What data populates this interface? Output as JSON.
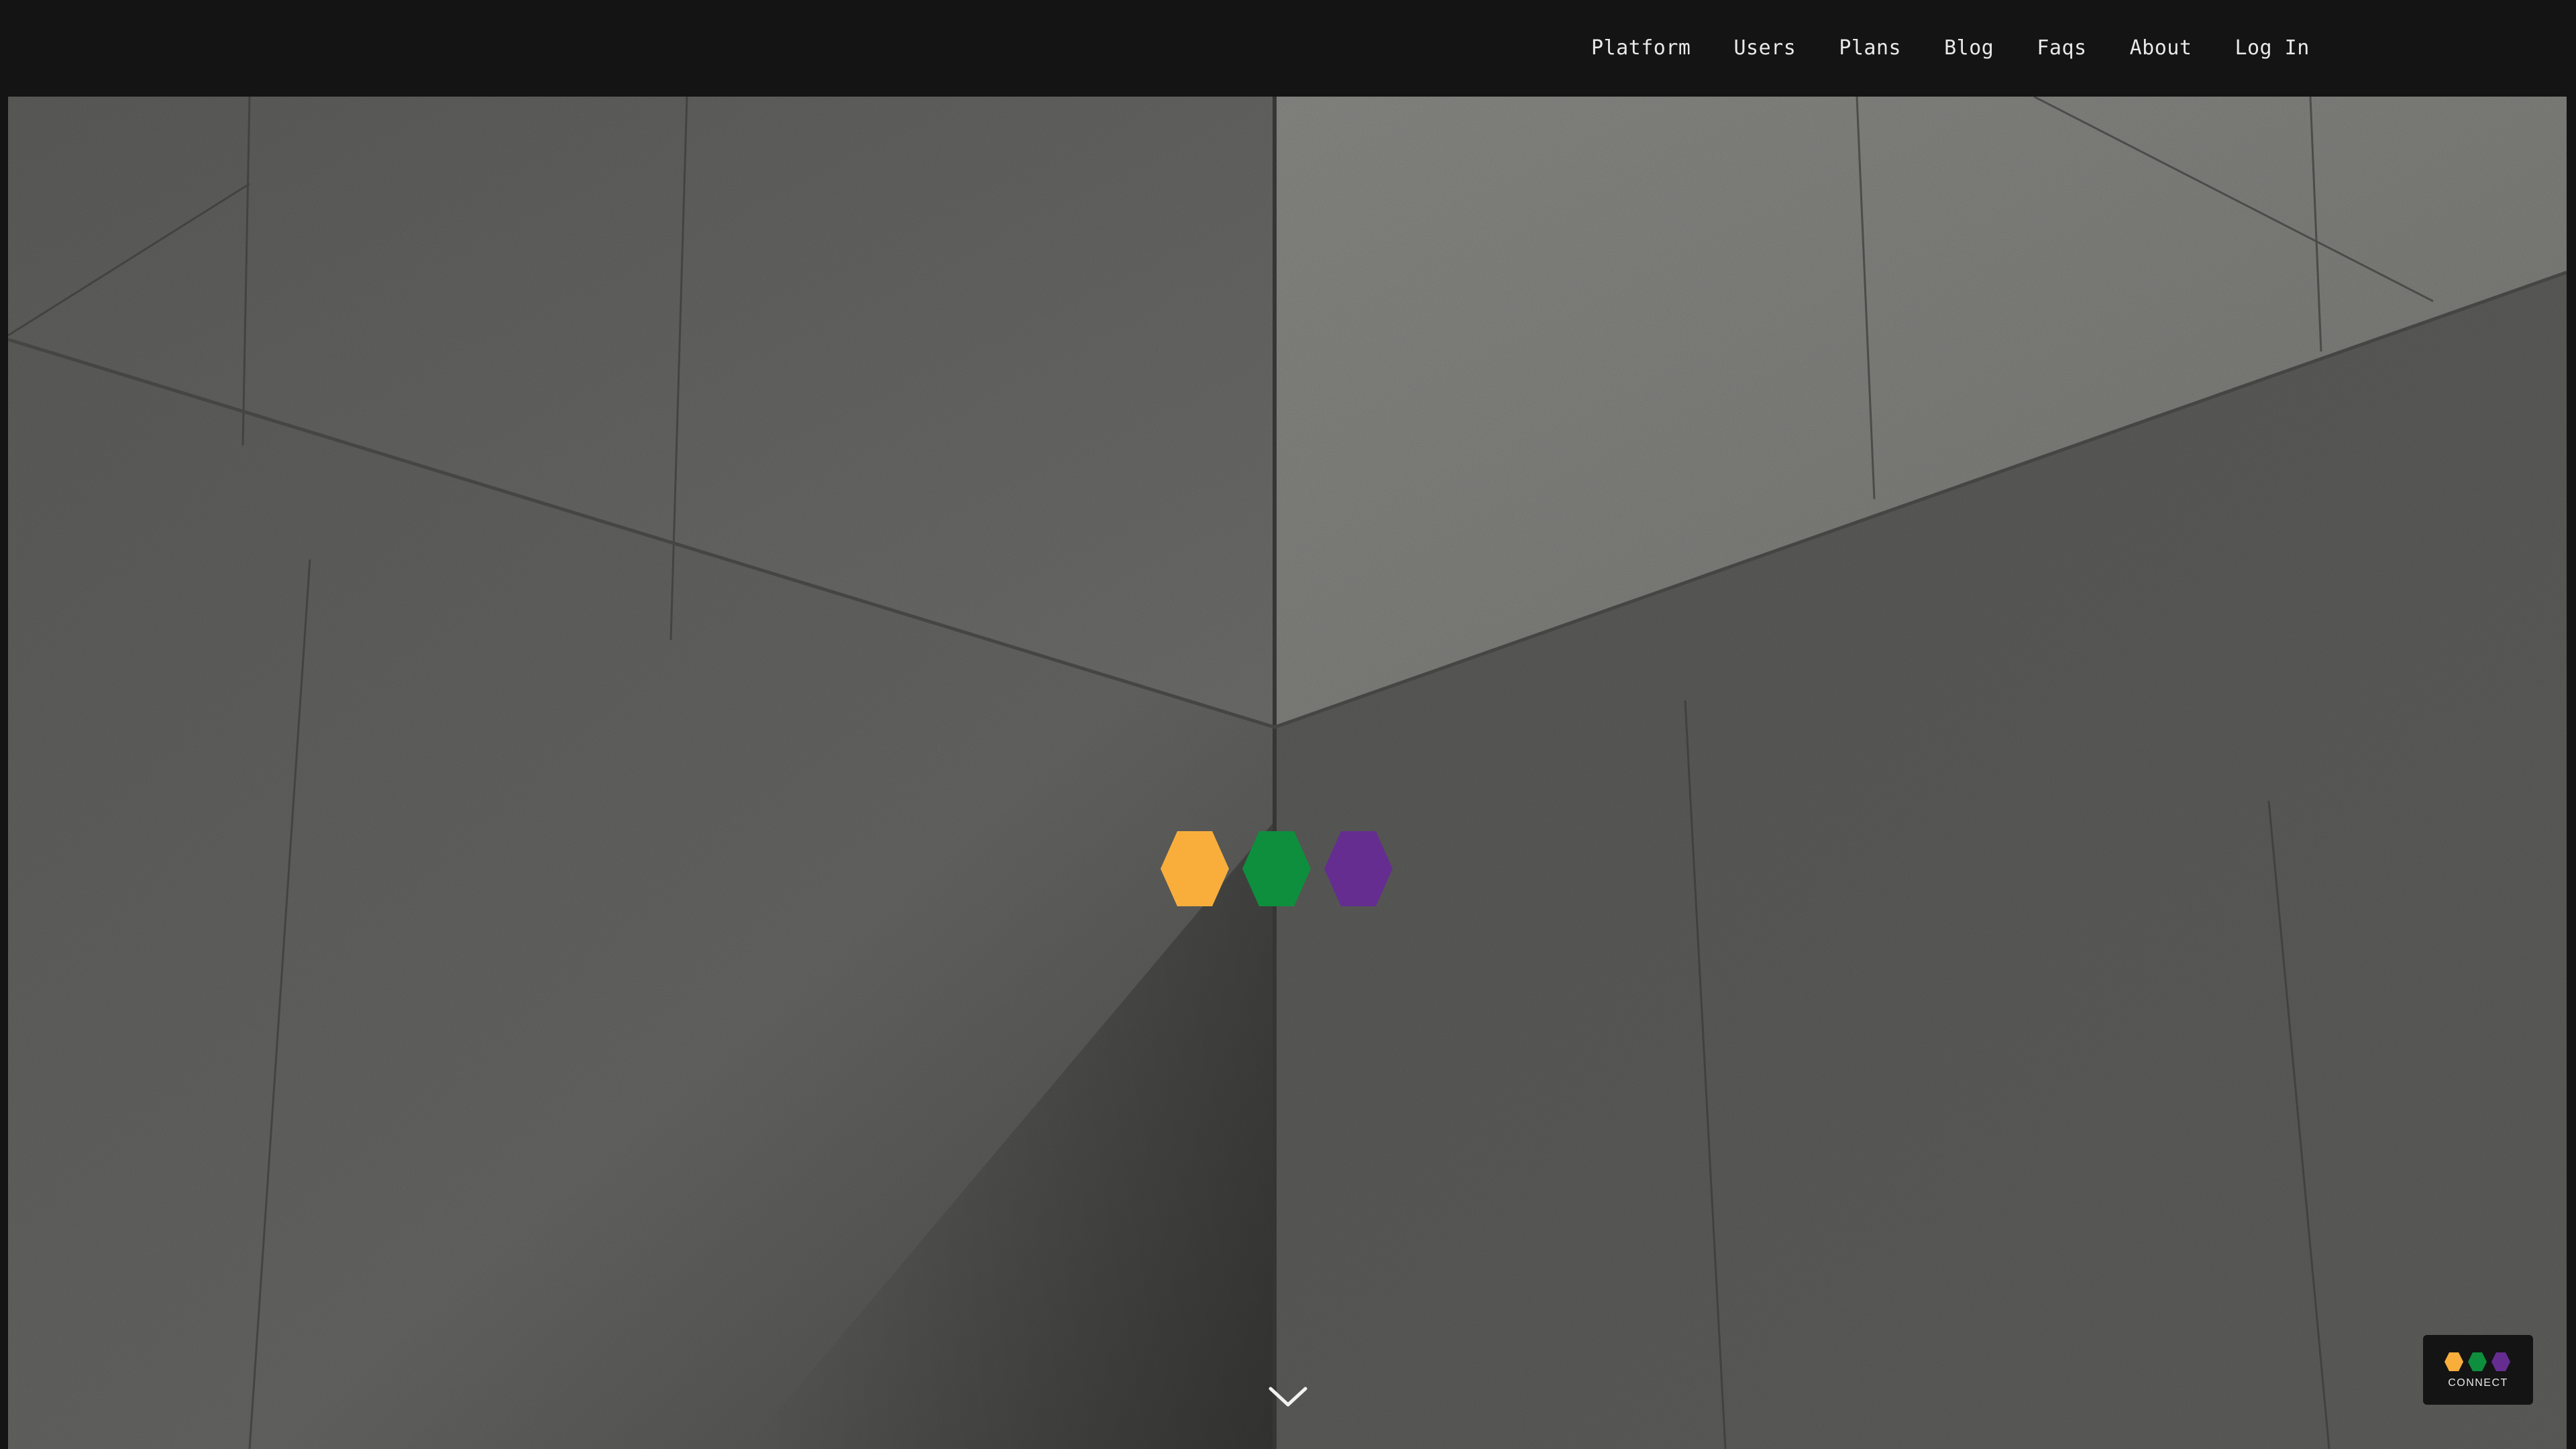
{
  "nav": {
    "items": [
      {
        "label": "Platform"
      },
      {
        "label": "Users"
      },
      {
        "label": "Plans"
      },
      {
        "label": "Blog"
      },
      {
        "label": "Faqs"
      },
      {
        "label": "About"
      },
      {
        "label": "Log In"
      }
    ]
  },
  "brand": {
    "colors": {
      "orange": "#F9AE3C",
      "green": "#0E8F3E",
      "purple": "#662D91"
    }
  },
  "hero": {
    "background": "concrete-walls-photo",
    "scroll_icon": "chevron-down-icon"
  },
  "connect_widget": {
    "label": "CONNECT",
    "icon": "hexagons-logo-icon"
  }
}
